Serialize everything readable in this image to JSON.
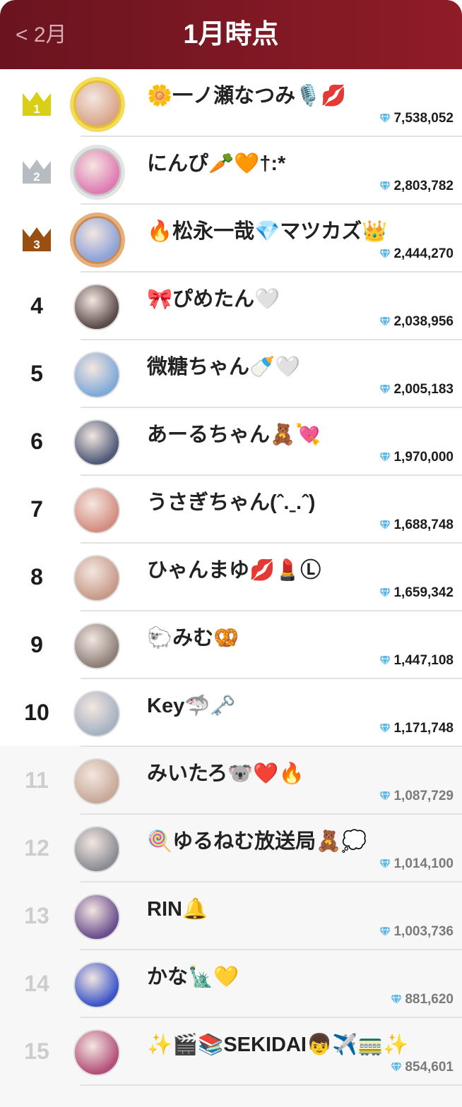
{
  "header": {
    "back_label": "< 2月",
    "title": "1月時点"
  },
  "colors": {
    "header_start": "#6a1420",
    "header_end": "#8f1c26",
    "gold": "#d8cf16",
    "silver": "#b7bcc3",
    "bronze": "#9a4f12",
    "gem": "#5ab4e6"
  },
  "ranking": [
    {
      "rank": "1",
      "name": "🌼一ノ瀬なつみ🎙️💋",
      "score": "7,538,052",
      "crown": "gold",
      "avatar_color": "#d9a58a"
    },
    {
      "rank": "2",
      "name": "にんぴ🥕🧡†:*",
      "score": "2,803,782",
      "crown": "silver",
      "avatar_color": "#e07ab3"
    },
    {
      "rank": "3",
      "name": "🔥松永一哉💎マツカズ👑",
      "score": "2,444,270",
      "crown": "bronze",
      "avatar_color": "#8ca2d8"
    },
    {
      "rank": "4",
      "name": "🎀ぴめたん🤍",
      "score": "2,038,956",
      "crown": "",
      "avatar_color": "#5a4a48"
    },
    {
      "rank": "5",
      "name": "微糖ちゃん🍼🤍",
      "score": "2,005,183",
      "crown": "",
      "avatar_color": "#7fa9d8"
    },
    {
      "rank": "6",
      "name": "あーるちゃん🧸💘",
      "score": "1,970,000",
      "crown": "",
      "avatar_color": "#4e5a78"
    },
    {
      "rank": "7",
      "name": "うさぎちゃん(ˆ.ˍ.ˆ)",
      "score": "1,688,748",
      "crown": "",
      "avatar_color": "#d48d80"
    },
    {
      "rank": "8",
      "name": "ひゃんまゆ💋💄Ⓛ",
      "score": "1,659,342",
      "crown": "",
      "avatar_color": "#c79a88"
    },
    {
      "rank": "9",
      "name": "🐑みむ🥨",
      "score": "1,447,108",
      "crown": "",
      "avatar_color": "#8d7f78"
    },
    {
      "rank": "10",
      "name": "Key🦈🗝️",
      "score": "1,171,748",
      "crown": "",
      "avatar_color": "#a6b2c2"
    },
    {
      "rank": "11",
      "name": "みいたろ🐨❤️🔥",
      "score": "1,087,729",
      "crown": "",
      "avatar_color": "#c8a997"
    },
    {
      "rank": "12",
      "name": "🍭ゆるねむ放送局🧸💭",
      "score": "1,014,100",
      "crown": "",
      "avatar_color": "#8a8c95"
    },
    {
      "rank": "13",
      "name": "RIN🔔",
      "score": "1,003,736",
      "crown": "",
      "avatar_color": "#6b4e8e"
    },
    {
      "rank": "14",
      "name": "かな🗽💛",
      "score": "881,620",
      "crown": "",
      "avatar_color": "#3b55c8"
    },
    {
      "rank": "15",
      "name": "✨🎬📚SEKIDAI👦✈️🚃✨",
      "score": "854,601",
      "crown": "",
      "avatar_color": "#b34f7a"
    }
  ]
}
